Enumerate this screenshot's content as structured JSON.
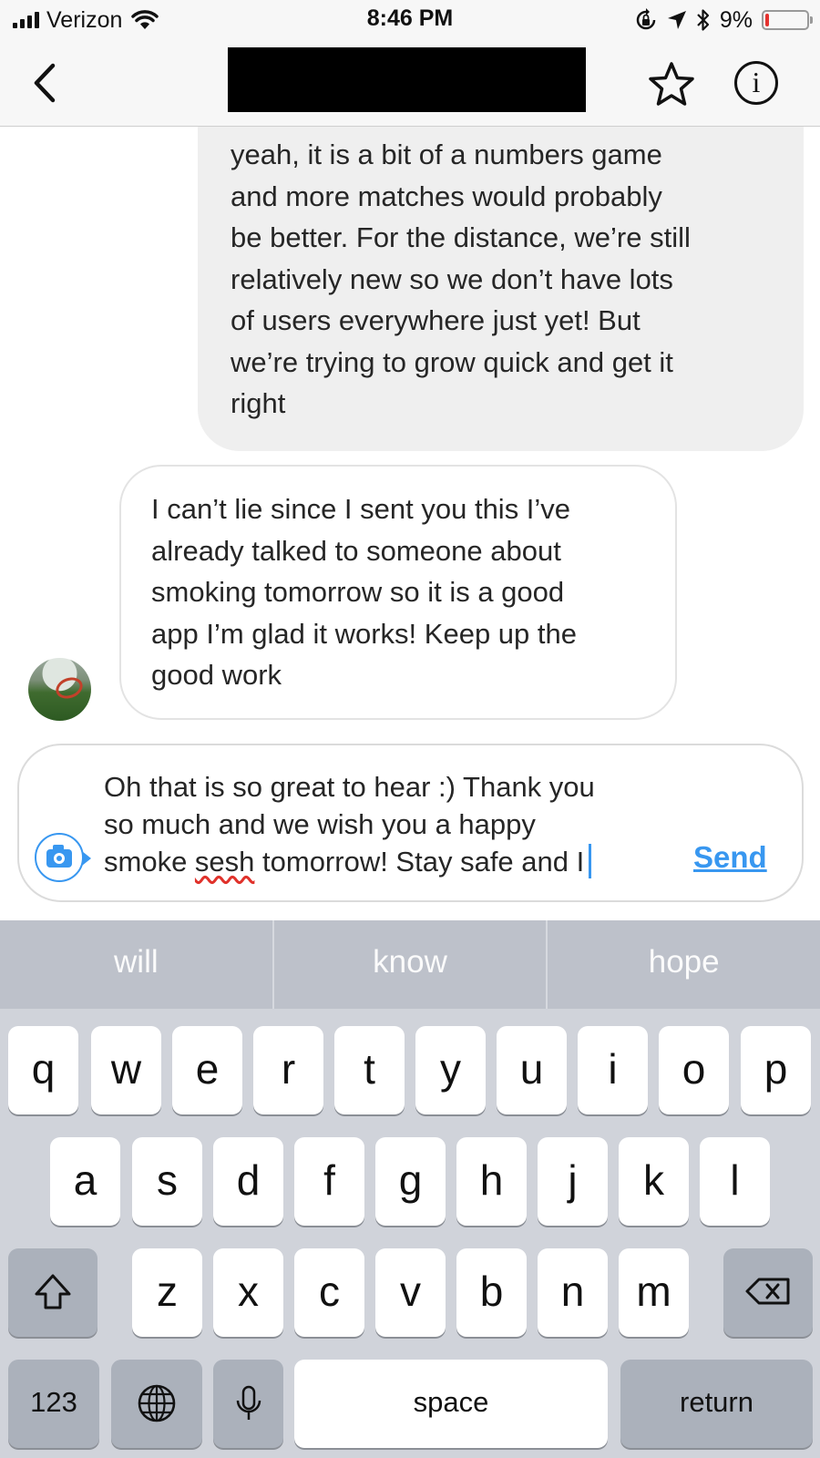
{
  "status_bar": {
    "carrier": "Verizon",
    "time": "8:46 PM",
    "battery_percent": "9%",
    "battery_level": 0.09,
    "icons": [
      "signal-icon",
      "wifi-icon",
      "rotation-lock-icon",
      "location-arrow-icon",
      "bluetooth-icon",
      "battery-icon"
    ]
  },
  "nav": {
    "icons": [
      "back-chevron-icon",
      "star-icon",
      "info-icon"
    ],
    "info_glyph": "i"
  },
  "thread": {
    "messages": [
      {
        "direction": "outgoing",
        "lines": [
          "yeah, it is a bit of a numbers game",
          "and more matches would probably",
          "be better. For the distance, we’re still",
          "relatively new so we don’t have lots",
          "of users everywhere just yet! But",
          "we’re trying to grow quick and get it",
          "right"
        ]
      },
      {
        "direction": "incoming",
        "lines": [
          "I can’t lie since I sent you this I’ve",
          "already talked to someone about",
          "smoking tomorrow so it is a good",
          "app I’m glad it works! Keep up the",
          "good work"
        ]
      }
    ]
  },
  "composer": {
    "line1": "Oh that is so great to hear :) Thank you",
    "line2": "so much and we wish you a happy",
    "line3_before": "smoke ",
    "line3_misspelled": "sesh",
    "line3_after": " tomorrow! Stay safe and I",
    "send_label": "Send",
    "accent_color": "#3897f0",
    "icon": "camera-icon"
  },
  "keyboard": {
    "predictions": [
      "will",
      "know",
      "hope"
    ],
    "row1": [
      "q",
      "w",
      "e",
      "r",
      "t",
      "y",
      "u",
      "i",
      "o",
      "p"
    ],
    "row2": [
      "a",
      "s",
      "d",
      "f",
      "g",
      "h",
      "j",
      "k",
      "l"
    ],
    "row3": [
      "z",
      "x",
      "c",
      "v",
      "b",
      "n",
      "m"
    ],
    "numbers_label": "123",
    "space_label": "space",
    "return_label": "return",
    "icons": [
      "shift-icon",
      "backspace-icon",
      "globe-icon",
      "microphone-icon"
    ]
  }
}
